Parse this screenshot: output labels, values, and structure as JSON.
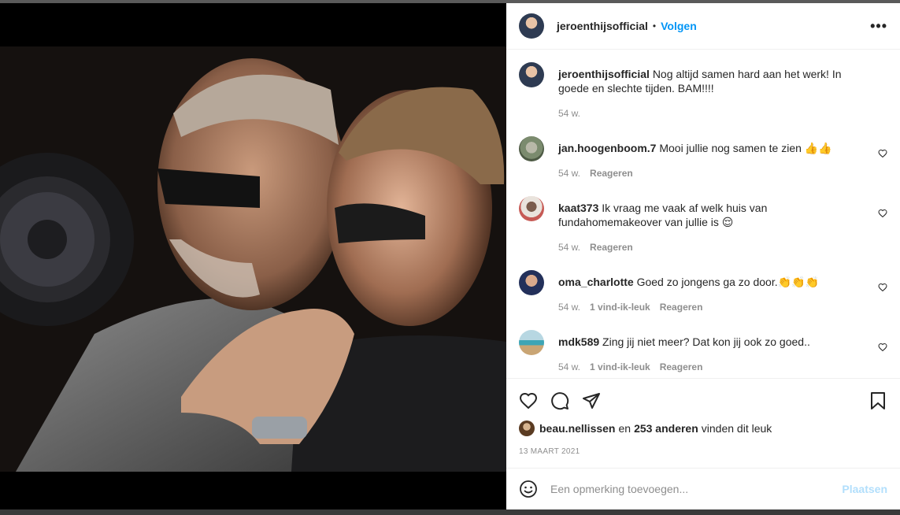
{
  "post": {
    "username": "jeroenthijsofficial",
    "follow_label": "Volgen",
    "dot": "•",
    "more_label": "•••"
  },
  "caption": {
    "username": "jeroenthijsofficial",
    "text": "Nog altijd samen hard aan het werk! In goede en slechte tijden. BAM!!!!",
    "time": "54 w."
  },
  "comments": [
    {
      "username": "jan.hoogenboom.7",
      "text": "Mooi jullie nog samen te zien 👍👍",
      "time": "54 w.",
      "likes": "",
      "reply": "Reageren"
    },
    {
      "username": "kaat373",
      "text": "Ik vraag me vaak af welk huis van fundahomemakeover van jullie is 😌",
      "time": "54 w.",
      "likes": "",
      "reply": "Reageren"
    },
    {
      "username": "oma_charlotte",
      "text": "Goed zo jongens ga zo door.👏👏👏",
      "time": "54 w.",
      "likes": "1 vind-ik-leuk",
      "reply": "Reageren"
    },
    {
      "username": "mdk589",
      "text": "Zing jij niet meer? Dat kon jij ook zo goed..",
      "time": "54 w.",
      "likes": "1 vind-ik-leuk",
      "reply": "Reageren"
    }
  ],
  "likes": {
    "user": "beau.nellissen",
    "connector": "en",
    "others": "253 anderen",
    "suffix": "vinden dit leuk"
  },
  "date": "13 MAART 2021",
  "add_comment": {
    "placeholder": "Een opmerking toevoegen...",
    "post_label": "Plaatsen"
  },
  "colors": {
    "accent": "#0095f6",
    "post_disabled": "#b2dffc",
    "text": "#262626",
    "muted": "#8e8e8e"
  },
  "icons": [
    "heart-icon",
    "comment-icon",
    "share-icon",
    "bookmark-icon",
    "emoji-icon",
    "more-icon"
  ]
}
